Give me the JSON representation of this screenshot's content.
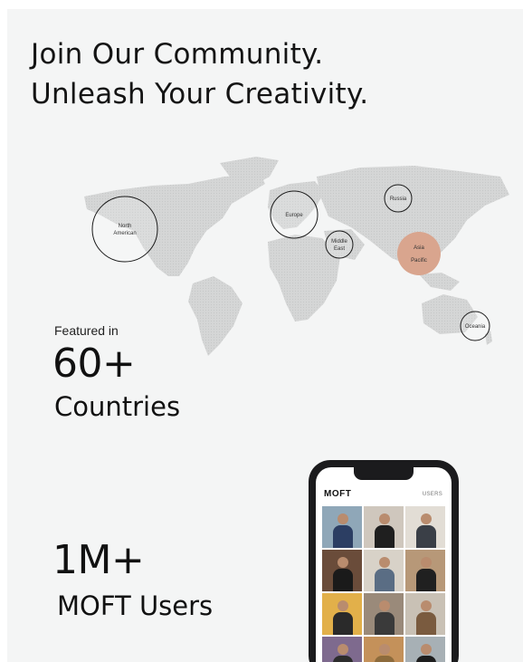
{
  "headline": {
    "line1": "Join Our Community.",
    "line2": "Unleash Your Creativity."
  },
  "map": {
    "regions": [
      {
        "label": "North American",
        "lines": [
          "North",
          "American"
        ],
        "highlight": false
      },
      {
        "label": "Europe",
        "lines": [
          "Europe"
        ],
        "highlight": false
      },
      {
        "label": "Russia",
        "lines": [
          "Russia"
        ],
        "highlight": false
      },
      {
        "label": "Middle East",
        "lines": [
          "Middle",
          "East"
        ],
        "highlight": false
      },
      {
        "label": "Asia Pacific",
        "lines": [
          "Asia",
          "Pacific"
        ],
        "highlight": true
      },
      {
        "label": "Oceania",
        "lines": [
          "Oceania"
        ],
        "highlight": false
      }
    ],
    "colors": {
      "land": "#d5d6d6",
      "highlight": "#d9a58e",
      "ring": "#1a1a1a"
    }
  },
  "stats": {
    "countries": {
      "prefix": "Featured in",
      "value": "60+",
      "label": "Countries"
    },
    "users": {
      "value": "1M+",
      "label": "MOFT Users"
    }
  },
  "phone": {
    "app_logo": "MOFT",
    "tab_label": "USERS",
    "tiles": [
      {
        "bg": "#8fa7b8",
        "shirt": "#2c3e63"
      },
      {
        "bg": "#cfc7bd",
        "shirt": "#1f1f1f"
      },
      {
        "bg": "#e2ddd5",
        "shirt": "#3a3f47"
      },
      {
        "bg": "#6a4c3a",
        "shirt": "#1a1a1a"
      },
      {
        "bg": "#d8d2c8",
        "shirt": "#5a6d84"
      },
      {
        "bg": "#b79878",
        "shirt": "#202020"
      },
      {
        "bg": "#e2b04a",
        "shirt": "#2a2a2a"
      },
      {
        "bg": "#9a8a7a",
        "shirt": "#3a3a3a"
      },
      {
        "bg": "#c9c1b5",
        "shirt": "#7a5b3f"
      },
      {
        "bg": "#7e6a8e",
        "shirt": "#2c2c2c"
      },
      {
        "bg": "#c4915a",
        "shirt": "#8d6b3c"
      },
      {
        "bg": "#a7b0b5",
        "shirt": "#1d1d1d"
      }
    ]
  }
}
